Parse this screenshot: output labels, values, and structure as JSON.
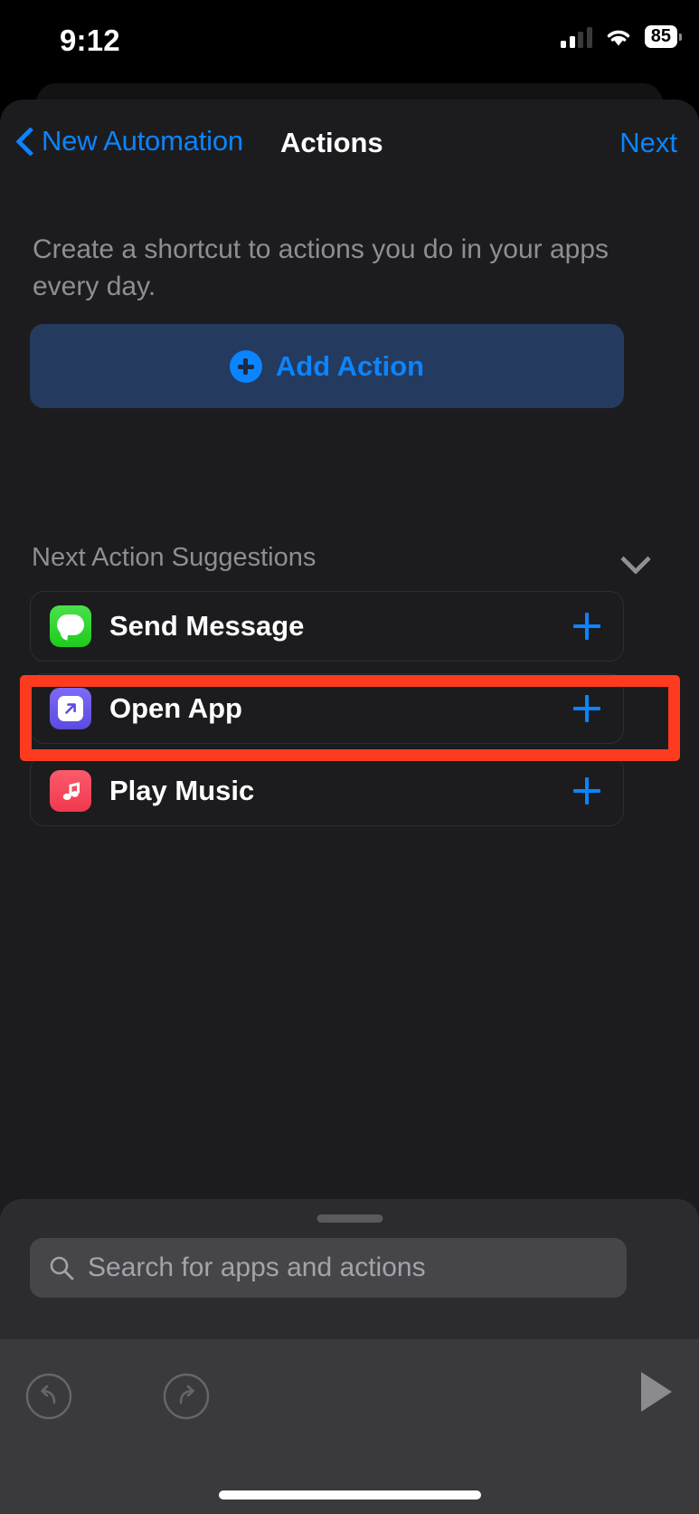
{
  "status_bar": {
    "time": "9:12",
    "battery_percent": "85",
    "cellular_icon": "cellular-bars-icon",
    "wifi_icon": "wifi-icon"
  },
  "nav": {
    "back_label": "New Automation",
    "back_icon": "chevron-left-icon",
    "title": "Actions",
    "next_label": "Next"
  },
  "main": {
    "intro_text": "Create a shortcut to actions you do in your apps every day.",
    "add_action": {
      "label": "Add Action",
      "icon": "plus-circle-icon",
      "background": "#243a5e",
      "accent": "#0a84ff"
    },
    "suggestions": {
      "header": "Next Action Suggestions",
      "collapse_icon": "chevron-down-icon",
      "items": [
        {
          "label": "Send Message",
          "icon": "messages-app-icon",
          "icon_color": "#30d158",
          "add_icon": "plus-icon"
        },
        {
          "label": "Open App",
          "icon": "open-app-icon",
          "icon_color": "#6b5bf0",
          "add_icon": "plus-icon",
          "highlighted": true
        },
        {
          "label": "Play Music",
          "icon": "music-app-icon",
          "icon_color": "#fa4159",
          "add_icon": "plus-icon"
        }
      ]
    }
  },
  "highlight": {
    "color": "#ff3b1f",
    "target": "Open App"
  },
  "bottom_sheet": {
    "grabber_icon": "drag-handle-icon",
    "search": {
      "placeholder": "Search for apps and actions",
      "value": "",
      "icon": "search-icon"
    },
    "toolbar": {
      "undo_icon": "undo-icon",
      "redo_icon": "redo-icon",
      "play_icon": "play-icon"
    }
  }
}
